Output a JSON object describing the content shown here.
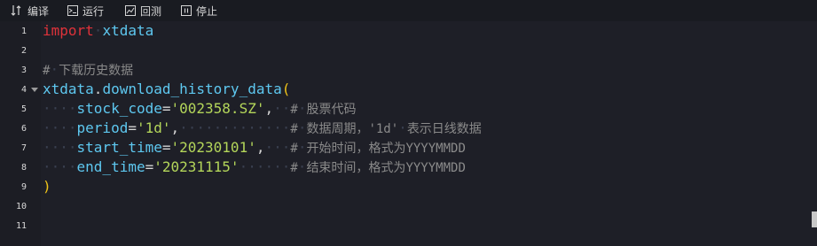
{
  "toolbar": {
    "compile_label": "编译",
    "run_label": "运行",
    "backtest_label": "回测",
    "stop_label": "停止"
  },
  "gutter": {
    "line_numbers": [
      "1",
      "2",
      "3",
      "4",
      "5",
      "6",
      "7",
      "8",
      "9",
      "10",
      "11"
    ]
  },
  "code": {
    "l1_kw": "import",
    "l1_ws": "·",
    "l1_mod": "xtdata",
    "l3_cm_hash": "#",
    "l3_ws": "·",
    "l3_cm": "下载历史数据",
    "l4_obj": "xtdata",
    "l4_dot": ".",
    "l4_fn": "download_history_data",
    "l4_paren": "(",
    "l5_ws": "····",
    "l5_param": "stock_code",
    "l5_eq": "=",
    "l5_val": "'002358.SZ'",
    "l5_comma": ",",
    "l5_ws2": "··",
    "l5_hash": "#",
    "l5_ws3": "·",
    "l5_cm": "股票代码",
    "l6_ws": "····",
    "l6_param": "period",
    "l6_eq": "=",
    "l6_val": "'1d'",
    "l6_comma": ",",
    "l6_ws2": "·············",
    "l6_hash": "#",
    "l6_ws3": "·",
    "l6_cm1": "数据周期，",
    "l6_cm2": "'1d'",
    "l6_ws4": "·",
    "l6_cm3": "表示日线数据",
    "l7_ws": "····",
    "l7_param": "start_time",
    "l7_eq": "=",
    "l7_val": "'20230101'",
    "l7_comma": ",",
    "l7_ws2": "···",
    "l7_hash": "#",
    "l7_ws3": "·",
    "l7_cm1": "开始时间，格式为",
    "l7_cm2": "YYYYMMDD",
    "l8_ws": "····",
    "l8_param": "end_time",
    "l8_eq": "=",
    "l8_val": "'20231115'",
    "l8_ws2": "······",
    "l8_hash": "#",
    "l8_ws3": "·",
    "l8_cm1": "结束时间，格式为",
    "l8_cm2": "YYYYMMDD",
    "l9_paren": ")"
  },
  "icons": {
    "compile": "compile-icon",
    "run": "run-icon",
    "backtest": "backtest-icon",
    "stop": "stop-icon"
  },
  "colors": {
    "keyword": "#e0323a",
    "function": "#5ec8f0",
    "string": "#b4d65a",
    "comment": "#8a8a8a",
    "paren": "#f0c419",
    "background": "#1e1f27"
  }
}
